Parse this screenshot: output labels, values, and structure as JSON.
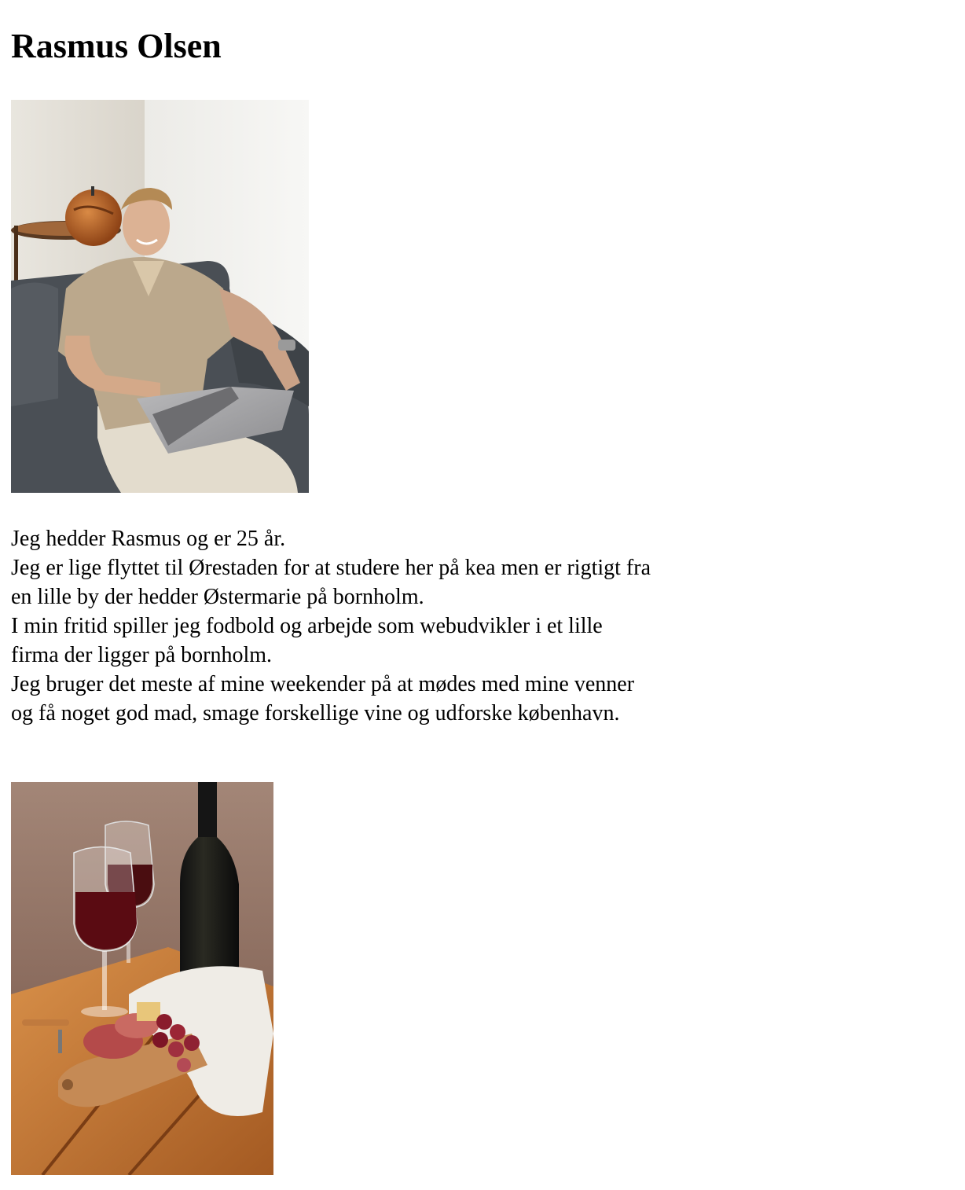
{
  "profile": {
    "name": "Rasmus Olsen"
  },
  "bio": {
    "lines": [
      "Jeg hedder Rasmus og er 25 år.",
      "Jeg er lige flyttet til Ørestaden for at studere her på kea men er rigtigt fra en lille by der hedder Østermarie på bornholm.",
      "I min fritid spiller jeg fodbold og arbejde som webudvikler i et lille firma der ligger på bornholm.",
      "Jeg bruger det meste af mine weekender på at mødes med mine venner og få noget god mad, smage forskellige vine og udforske københavn."
    ]
  },
  "images": {
    "portrait_icon": "person-with-laptop-photo",
    "wine_icon": "wine-and-charcuterie-photo"
  }
}
